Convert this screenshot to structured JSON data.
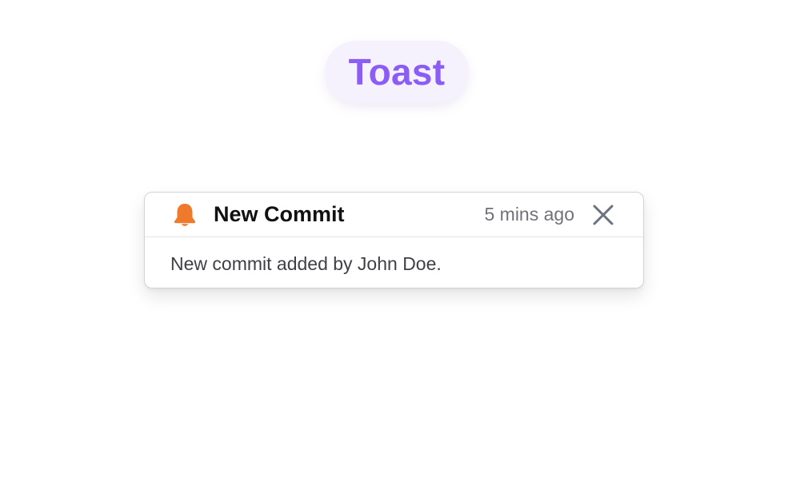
{
  "header": {
    "title": "Toast"
  },
  "toast": {
    "icon": "bell-icon",
    "icon_color": "#f07a2c",
    "title": "New Commit",
    "time": "5 mins ago",
    "close_icon": "close-icon",
    "message": "New commit added by John Doe."
  },
  "colors": {
    "accent": "#8b5cf6",
    "pill_background": "#f5f2fe",
    "border": "#d4d4d8"
  }
}
